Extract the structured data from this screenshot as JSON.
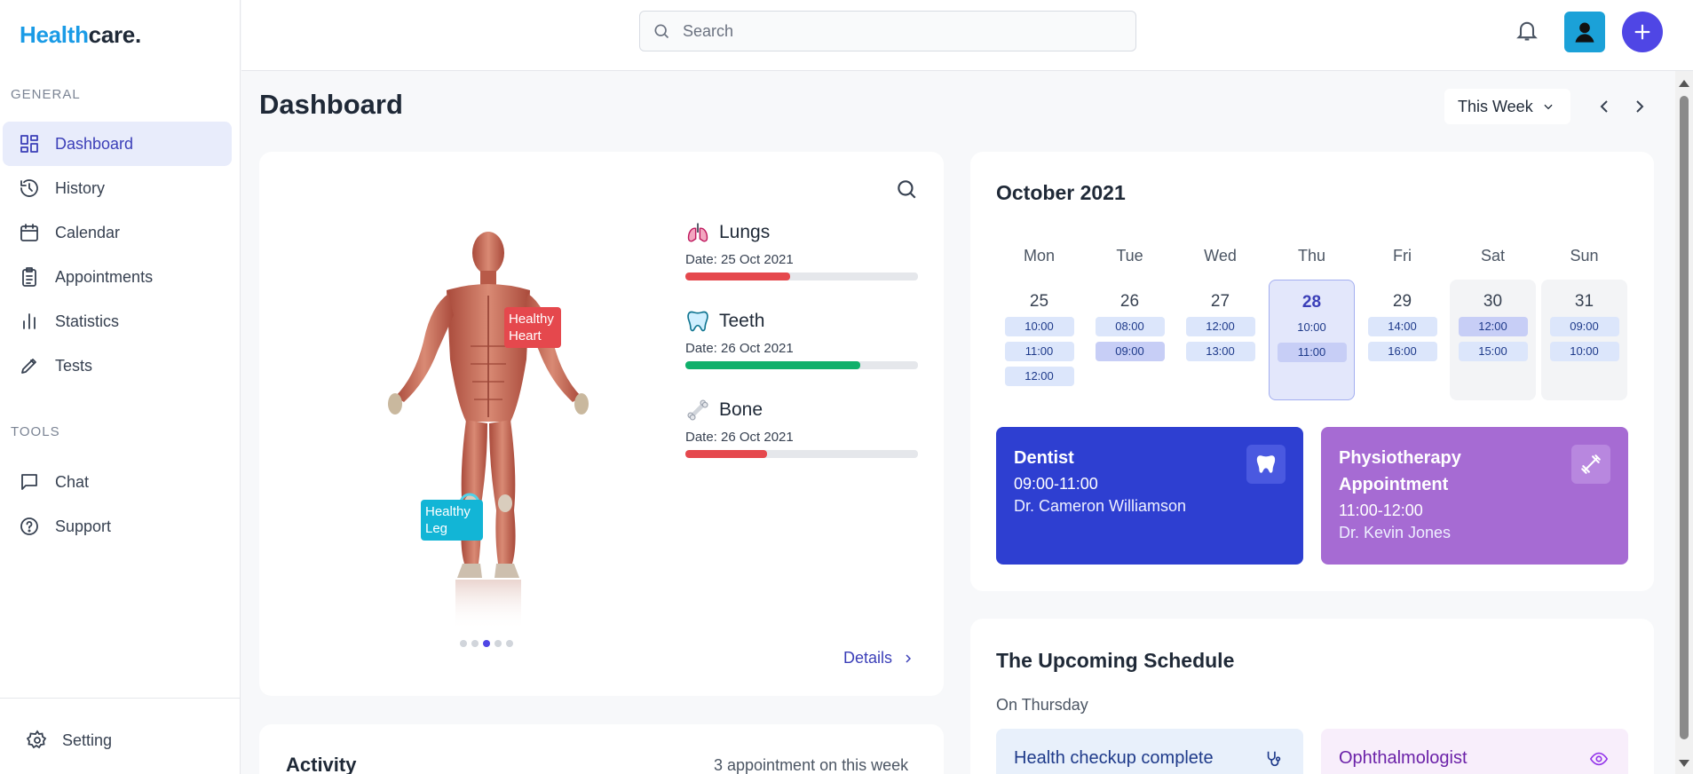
{
  "brand": {
    "part1": "Health",
    "part2": "care."
  },
  "sidebar": {
    "general_title": "GENERAL",
    "tools_title": "TOOLS",
    "items": [
      {
        "label": "Dashboard",
        "icon": "grid-icon"
      },
      {
        "label": "History",
        "icon": "history-icon"
      },
      {
        "label": "Calendar",
        "icon": "calendar-icon"
      },
      {
        "label": "Appointments",
        "icon": "clipboard-icon"
      },
      {
        "label": "Statistics",
        "icon": "bar-chart-icon"
      },
      {
        "label": "Tests",
        "icon": "pen-icon"
      }
    ],
    "tools": [
      {
        "label": "Chat",
        "icon": "chat-icon"
      },
      {
        "label": "Support",
        "icon": "help-icon"
      }
    ],
    "setting_label": "Setting"
  },
  "topbar": {
    "search_placeholder": "Search"
  },
  "page": {
    "title": "Dashboard",
    "week_select": "This Week"
  },
  "body_card": {
    "tags": {
      "heart": "Healthy Heart",
      "leg": "Healthy Leg"
    },
    "organs": [
      {
        "name": "Lungs",
        "date": "Date: 25 Oct 2021",
        "progress": 0.45,
        "color": "#e5484d"
      },
      {
        "name": "Teeth",
        "date": "Date: 26 Oct 2021",
        "progress": 0.75,
        "color": "#10b06b"
      },
      {
        "name": "Bone",
        "date": "Date: 26 Oct 2021",
        "progress": 0.35,
        "color": "#e5484d"
      }
    ],
    "carousel_active": 3,
    "details_label": "Details"
  },
  "calendar": {
    "title": "October 2021",
    "days": [
      {
        "name": "Mon",
        "num": "25",
        "slots": [
          "10:00",
          "11:00",
          "12:00"
        ]
      },
      {
        "name": "Tue",
        "num": "26",
        "slots": [
          "08:00",
          "09:00"
        ]
      },
      {
        "name": "Wed",
        "num": "27",
        "slots": [
          "12:00",
          "13:00"
        ]
      },
      {
        "name": "Thu",
        "num": "28",
        "slots": [
          "10:00",
          "11:00"
        ]
      },
      {
        "name": "Fri",
        "num": "29",
        "slots": [
          "14:00",
          "16:00"
        ]
      },
      {
        "name": "Sat",
        "num": "30",
        "slots": [
          "12:00",
          "15:00"
        ]
      },
      {
        "name": "Sun",
        "num": "31",
        "slots": [
          "09:00",
          "10:00"
        ]
      }
    ],
    "appointments": [
      {
        "title": "Dentist",
        "time": "09:00-11:00",
        "doctor": "Dr. Cameron Williamson"
      },
      {
        "title": "Physiotherapy Appointment",
        "time": "11:00-12:00",
        "doctor": "Dr. Kevin Jones"
      }
    ]
  },
  "activity": {
    "title": "Activity",
    "meta": "3 appointment on this week"
  },
  "schedule": {
    "title": "The Upcoming Schedule",
    "subtitle": "On Thursday",
    "items": [
      {
        "title": "Health checkup complete"
      },
      {
        "title": "Ophthalmologist"
      }
    ]
  }
}
